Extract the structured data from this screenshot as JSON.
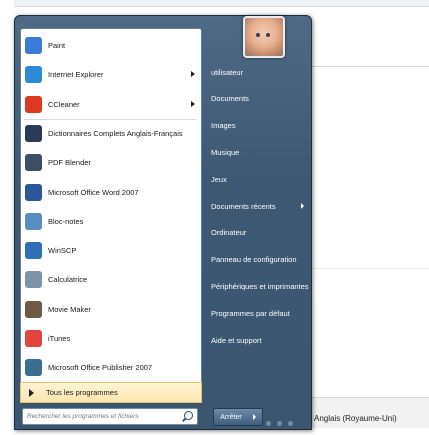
{
  "programs": [
    {
      "label": "Paint",
      "icon": "paint-icon",
      "color": "#3a7bd5",
      "submenu": false
    },
    {
      "label": "Internet Explorer",
      "icon": "internet-explorer-icon",
      "color": "#2d8ad6",
      "submenu": true
    },
    {
      "label": "CCleaner",
      "icon": "ccleaner-icon",
      "color": "#d93a20",
      "submenu": true
    },
    {
      "label": "Dictionnaires Complets Anglais-Français",
      "icon": "dictionary-icon",
      "color": "#2b3a55",
      "submenu": false
    },
    {
      "label": "PDF Blender",
      "icon": "pdf-blender-icon",
      "color": "#3d4f66",
      "submenu": false
    },
    {
      "label": "Microsoft Office Word 2007",
      "icon": "word-icon",
      "color": "#2b579a",
      "submenu": false
    },
    {
      "label": "Bloc-notes",
      "icon": "notepad-icon",
      "color": "#5a8cc4",
      "submenu": false
    },
    {
      "label": "WinSCP",
      "icon": "winscp-icon",
      "color": "#2e6fb5",
      "submenu": false
    },
    {
      "label": "Calculatrice",
      "icon": "calculator-icon",
      "color": "#7d93a8",
      "submenu": false
    },
    {
      "label": "Movie Maker",
      "icon": "movie-maker-icon",
      "color": "#6f5a45",
      "submenu": false
    },
    {
      "label": "iTunes",
      "icon": "itunes-icon",
      "color": "#e0463e",
      "submenu": false
    },
    {
      "label": "Microsoft Office Publisher 2007",
      "icon": "publisher-icon",
      "color": "#3a6e8f",
      "submenu": false
    }
  ],
  "all_programs_label": "Tous les programmes",
  "search": {
    "placeholder": "Rechercher les programmes et fichiers"
  },
  "right_items": [
    {
      "label": "utilisateur",
      "submenu": false
    },
    {
      "label": "Documents",
      "submenu": false
    },
    {
      "label": "Images",
      "submenu": false
    },
    {
      "label": "Musique",
      "submenu": false
    },
    {
      "label": "Jeux",
      "submenu": false
    },
    {
      "label": "Documents récents",
      "submenu": true
    },
    {
      "label": "Ordinateur",
      "submenu": false
    },
    {
      "label": "Panneau de configuration",
      "submenu": false
    },
    {
      "label": "Périphériques et imprimantes",
      "submenu": false
    },
    {
      "label": "Programmes par défaut",
      "submenu": false
    },
    {
      "label": "Aide et support",
      "submenu": false
    }
  ],
  "shutdown_label": "Arrêter",
  "language_label": "Anglais (Royaume-Uni)"
}
